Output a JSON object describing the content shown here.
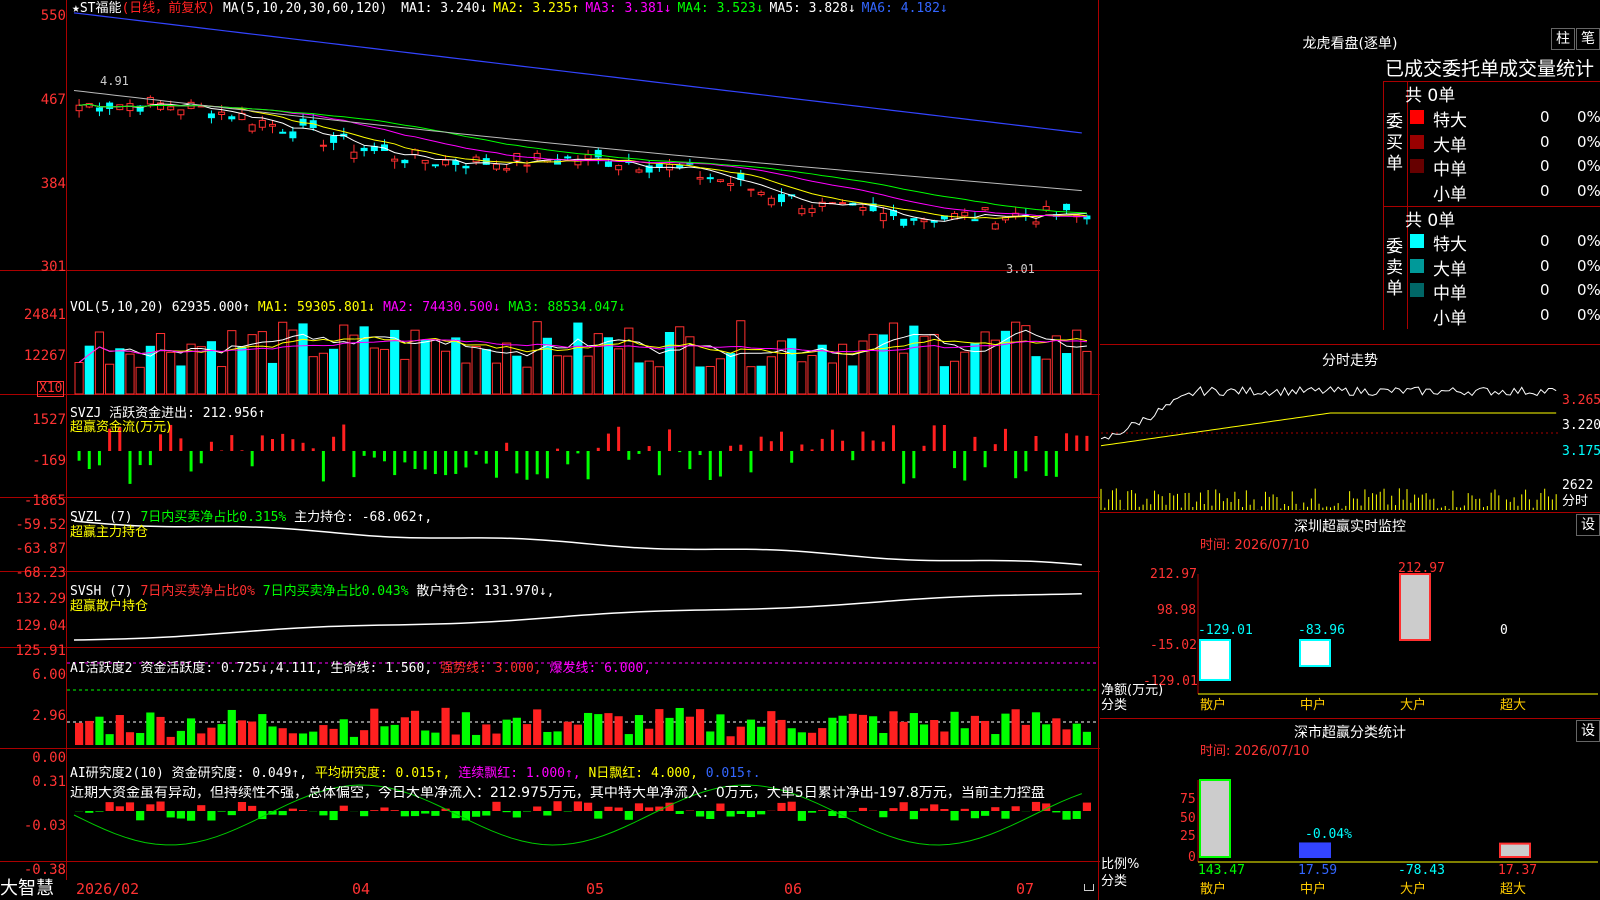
{
  "main": {
    "stock_label": "★ST福能",
    "period_label": "(日线，前复权)",
    "ma_label": "MA(5,10,20,30,60,120)",
    "ma_values": [
      {
        "text": "MA1: 3.240↓",
        "color": "#ffffff"
      },
      {
        "text": "MA2: 3.235↑",
        "color": "#ffff00"
      },
      {
        "text": "MA3: 3.381↓",
        "color": "#ff00ff"
      },
      {
        "text": "MA4: 3.523↓",
        "color": "#00ff00"
      },
      {
        "text": "MA5: 3.828↓",
        "color": "#ffffff"
      },
      {
        "text": "MA6: 4.182↓",
        "color": "#3366ff"
      }
    ],
    "y_ticks": [
      "550",
      "467",
      "384",
      "301"
    ],
    "high_marker": "4.91",
    "low_marker": "3.01"
  },
  "vol": {
    "header": "VOL(5,10,20)",
    "value": "62935.000↑",
    "ma1": "MA1: 59305.801↓",
    "ma2": "MA2: 74430.500↓",
    "ma3": "MA3: 88534.047↓",
    "y_ticks": [
      "24841",
      "12267"
    ],
    "unit": "X10"
  },
  "svzj": {
    "header": "SVZJ  活跃资金进出: 212.956↑",
    "sub": "超赢资金流(万元)",
    "y_ticks": [
      "1527",
      "-169",
      "-1865"
    ]
  },
  "svzl": {
    "header": "SVZL (7)",
    "ratio": "7日内买卖净占比0.315%",
    "holding": "主力持仓: -68.062↑,",
    "sub": "超赢主力持仓",
    "y_ticks": [
      "-59.52",
      "-63.87",
      "-68.23"
    ]
  },
  "svsh": {
    "header": "SVSH (7)",
    "ratio1": "7日内买卖净占比0%",
    "ratio2": "7日内买卖净占比0.043%",
    "holding": "散户持仓: 131.970↓,",
    "sub": "超赢散户持仓",
    "y_ticks": [
      "132.29",
      "129.04",
      "125.91"
    ]
  },
  "ai_act": {
    "header": "AI活跃度2",
    "v1": "资金活跃度: 0.725↓,4.111,",
    "v2": "生命线: 1.560,",
    "v3": "强势线: 3.000,",
    "v4": "爆发线: 6.000,",
    "y_ticks": [
      "6.00",
      "2.96",
      "0.00"
    ]
  },
  "ai_res": {
    "header": "AI研究度2(10)",
    "v1": "资金研究度: 0.049↑,",
    "v2": "平均研究度: 0.015↑,",
    "v3": "连续飘红: 1.000↑,",
    "v4": "N日飘红: 4.000,",
    "v5": "0.015↑.",
    "comment": "近期大资金虽有异动，但持续性不强，总体偏空，今日大单净流入：212.975万元，其中特大单净流入：0万元，大单5日累计净出-197.8万元，当前主力控盘",
    "y_ticks": [
      "0.31",
      "-0.03",
      "-0.38"
    ]
  },
  "bottom": {
    "brand": "大智慧",
    "dates": [
      "2026/02",
      "04",
      "05",
      "06",
      "07"
    ]
  },
  "right": {
    "title": "龙虎看盘(逐单)",
    "btn_zhu": "柱",
    "btn_bi": "笔",
    "stats_title": "已成交委托单成交量统计",
    "buy_group": {
      "label": "委买单",
      "total": "共 0单",
      "rows": [
        {
          "name": "特大",
          "count": "0",
          "pct": "0%",
          "color": "#ff0000"
        },
        {
          "name": "大单",
          "count": "0",
          "pct": "0%",
          "color": "#990000"
        },
        {
          "name": "中单",
          "count": "0",
          "pct": "0%",
          "color": "#660000"
        },
        {
          "name": "小单",
          "count": "0",
          "pct": "0%",
          "color": "#000000"
        }
      ]
    },
    "sell_group": {
      "label": "委卖单",
      "total": "共 0单",
      "rows": [
        {
          "name": "特大",
          "count": "0",
          "pct": "0%",
          "color": "#00ffff"
        },
        {
          "name": "大单",
          "count": "0",
          "pct": "0%",
          "color": "#009999"
        },
        {
          "name": "中单",
          "count": "0",
          "pct": "0%",
          "color": "#006666"
        },
        {
          "name": "小单",
          "count": "0",
          "pct": "0%",
          "color": "#000000"
        }
      ]
    },
    "intraday": {
      "title": "分时走势",
      "y_ticks": [
        "3.265",
        "3.220",
        "3.175"
      ],
      "vol_label": "2622",
      "vol_unit": "分时"
    },
    "sz_monitor": {
      "title": "深圳超赢实时监控",
      "settings": "设",
      "time": "时间: 2026/07/10",
      "y_ticks": [
        "212.97",
        "98.98",
        "-15.02",
        "-129.01"
      ],
      "y_label": "净额(万元)",
      "x_label": "分类",
      "categories": [
        "散户",
        "中户",
        "大户",
        "超大"
      ],
      "values": [
        -129.01,
        -83.96,
        212.97,
        0
      ],
      "value_labels": [
        "-129.01",
        "-83.96",
        "212.97",
        "0"
      ]
    },
    "sz_classify": {
      "title": "深市超赢分类统计",
      "settings": "设",
      "time": "时间: 2026/07/10",
      "y_ticks": [
        "75",
        "50",
        "25",
        "0"
      ],
      "y_label": "比例%",
      "x_label": "分类",
      "categories": [
        "散户",
        "中户",
        "大户",
        "超大"
      ],
      "values": [
        143.47,
        17.59,
        -78.43,
        17.37
      ],
      "value_labels": [
        "143.47",
        "17.59",
        "-78.43",
        "17.37"
      ],
      "mid_label": "-0.04%"
    }
  }
}
